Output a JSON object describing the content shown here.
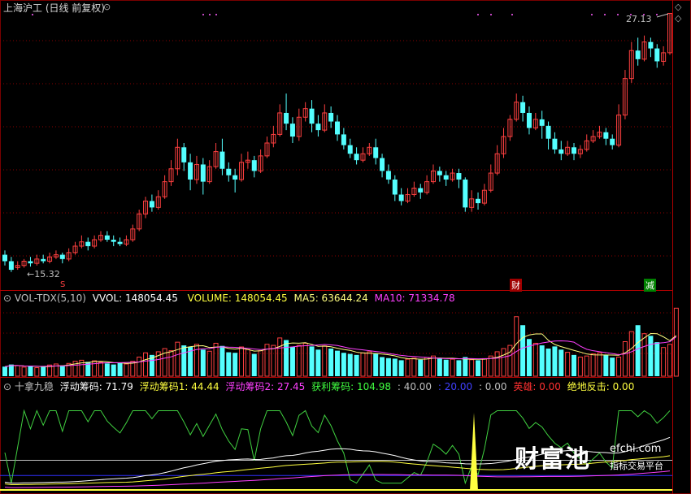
{
  "main": {
    "title": "上海沪工 (日线 前复权)",
    "high_label": "27.13",
    "low_label": "←15.32",
    "marker_s": "S",
    "marker_cai": "财",
    "marker_jian": "减",
    "candles": [
      [
        15.9,
        15.6,
        16.1,
        15.4
      ],
      [
        15.6,
        15.2,
        15.8,
        15.1
      ],
      [
        15.3,
        15.4,
        15.6,
        15.2
      ],
      [
        15.4,
        15.6,
        15.7,
        15.3
      ],
      [
        15.6,
        15.5,
        15.8,
        15.35
      ],
      [
        15.5,
        15.7,
        15.9,
        15.4
      ],
      [
        15.7,
        15.6,
        15.9,
        15.5
      ],
      [
        15.6,
        15.8,
        16.0,
        15.5
      ],
      [
        15.8,
        15.9,
        16.1,
        15.7
      ],
      [
        15.9,
        15.7,
        16.0,
        15.5
      ],
      [
        15.7,
        16.0,
        16.2,
        15.6
      ],
      [
        16.0,
        16.3,
        16.5,
        15.9
      ],
      [
        16.3,
        16.5,
        16.8,
        16.2
      ],
      [
        16.5,
        16.3,
        16.7,
        16.1
      ],
      [
        16.3,
        16.6,
        16.8,
        16.2
      ],
      [
        16.6,
        16.8,
        17.0,
        16.5
      ],
      [
        16.8,
        16.6,
        17.0,
        16.5
      ],
      [
        16.6,
        16.5,
        16.8,
        16.3
      ],
      [
        16.5,
        16.4,
        16.7,
        16.3
      ],
      [
        16.4,
        16.6,
        16.8,
        16.3
      ],
      [
        16.6,
        17.1,
        17.3,
        16.5
      ],
      [
        17.1,
        17.8,
        18.0,
        17.0
      ],
      [
        17.8,
        18.4,
        18.6,
        17.6
      ],
      [
        18.4,
        18.1,
        18.7,
        17.9
      ],
      [
        18.1,
        18.6,
        18.9,
        18.0
      ],
      [
        18.6,
        19.3,
        19.6,
        18.5
      ],
      [
        19.3,
        19.9,
        20.3,
        19.1
      ],
      [
        19.9,
        20.9,
        21.3,
        19.6
      ],
      [
        20.9,
        20.2,
        21.1,
        19.8
      ],
      [
        20.2,
        19.4,
        20.6,
        18.9
      ],
      [
        19.4,
        20.1,
        20.5,
        19.2
      ],
      [
        20.1,
        19.3,
        20.4,
        18.7
      ],
      [
        19.3,
        20.0,
        20.3,
        19.2
      ],
      [
        20.0,
        20.7,
        21.1,
        19.9
      ],
      [
        20.7,
        19.9,
        21.3,
        19.6
      ],
      [
        19.9,
        19.6,
        20.2,
        19.3
      ],
      [
        19.6,
        19.4,
        19.9,
        18.8
      ],
      [
        19.4,
        20.2,
        20.6,
        19.3
      ],
      [
        20.2,
        20.3,
        20.7,
        19.9
      ],
      [
        20.3,
        19.8,
        20.5,
        19.5
      ],
      [
        19.8,
        20.5,
        20.8,
        19.7
      ],
      [
        20.5,
        21.1,
        21.4,
        20.4
      ],
      [
        21.1,
        21.5,
        21.9,
        20.9
      ],
      [
        21.5,
        22.5,
        22.9,
        21.4
      ],
      [
        22.5,
        22.0,
        23.4,
        21.7
      ],
      [
        22.0,
        21.4,
        22.3,
        21.1
      ],
      [
        21.4,
        22.3,
        22.7,
        21.2
      ],
      [
        22.3,
        22.7,
        23.0,
        22.1
      ],
      [
        22.7,
        22.0,
        23.1,
        21.6
      ],
      [
        22.0,
        21.7,
        22.4,
        21.4
      ],
      [
        21.7,
        22.5,
        22.9,
        21.6
      ],
      [
        22.5,
        22.1,
        22.8,
        21.8
      ],
      [
        22.1,
        21.5,
        22.4,
        21.2
      ],
      [
        21.5,
        21.0,
        21.8,
        20.8
      ],
      [
        21.0,
        20.6,
        21.3,
        20.4
      ],
      [
        20.6,
        20.3,
        20.9,
        20.1
      ],
      [
        20.3,
        20.6,
        20.9,
        20.2
      ],
      [
        20.6,
        20.9,
        21.1,
        20.5
      ],
      [
        20.9,
        20.4,
        21.3,
        20.1
      ],
      [
        20.4,
        19.8,
        20.6,
        19.5
      ],
      [
        19.8,
        19.4,
        20.1,
        19.2
      ],
      [
        19.4,
        18.7,
        19.6,
        18.4
      ],
      [
        18.7,
        18.4,
        19.0,
        18.2
      ],
      [
        18.4,
        18.7,
        19.0,
        18.3
      ],
      [
        18.7,
        19.0,
        19.3,
        18.6
      ],
      [
        19.0,
        18.8,
        19.2,
        18.5
      ],
      [
        18.8,
        19.3,
        19.6,
        18.7
      ],
      [
        19.3,
        19.8,
        20.1,
        19.2
      ],
      [
        19.8,
        19.6,
        20.0,
        19.3
      ],
      [
        19.6,
        19.4,
        19.8,
        19.1
      ],
      [
        19.4,
        19.7,
        19.9,
        19.3
      ],
      [
        19.7,
        19.4,
        19.9,
        19.0
      ],
      [
        19.4,
        18.1,
        19.5,
        17.9
      ],
      [
        18.1,
        18.5,
        18.9,
        17.9
      ],
      [
        18.5,
        18.3,
        18.8,
        18.0
      ],
      [
        18.3,
        18.9,
        19.2,
        18.2
      ],
      [
        18.9,
        19.7,
        20.1,
        18.8
      ],
      [
        19.7,
        20.6,
        21.0,
        19.6
      ],
      [
        20.6,
        21.4,
        21.8,
        20.4
      ],
      [
        21.4,
        22.2,
        22.4,
        21.2
      ],
      [
        22.2,
        23.0,
        23.4,
        22.1
      ],
      [
        23.0,
        22.5,
        23.3,
        22.1
      ],
      [
        22.5,
        21.8,
        22.8,
        21.5
      ],
      [
        21.8,
        22.2,
        22.5,
        21.7
      ],
      [
        22.2,
        21.9,
        22.6,
        21.3
      ],
      [
        21.9,
        21.3,
        22.1,
        20.8
      ],
      [
        21.3,
        20.8,
        21.6,
        20.6
      ],
      [
        20.8,
        20.6,
        21.2,
        20.3
      ],
      [
        20.6,
        20.9,
        21.2,
        20.5
      ],
      [
        20.9,
        20.6,
        21.1,
        20.3
      ],
      [
        20.6,
        20.8,
        21.0,
        20.4
      ],
      [
        20.8,
        21.2,
        21.5,
        20.7
      ],
      [
        21.2,
        21.4,
        21.7,
        21.1
      ],
      [
        21.4,
        21.6,
        21.9,
        21.3
      ],
      [
        21.6,
        21.3,
        21.8,
        21.0
      ],
      [
        21.3,
        21.0,
        21.5,
        20.8
      ],
      [
        21.0,
        22.4,
        22.9,
        20.9
      ],
      [
        22.4,
        24.1,
        24.5,
        22.2
      ],
      [
        24.1,
        25.4,
        25.8,
        23.9
      ],
      [
        25.4,
        25.0,
        26.0,
        24.7
      ],
      [
        25.0,
        25.8,
        26.1,
        24.9
      ],
      [
        25.8,
        25.5,
        26.0,
        25.1
      ],
      [
        25.5,
        24.9,
        25.7,
        24.6
      ],
      [
        24.9,
        25.3,
        25.6,
        24.7
      ],
      [
        25.3,
        27.13,
        27.13,
        25.2
      ]
    ]
  },
  "vol": {
    "title": "VOL-TDX(5,10)",
    "vvol": "VVOL: 148054.45",
    "volume": "VOLUME: 148054.45",
    "ma5": "MA5: 63644.24",
    "ma10": "MA10: 71334.78",
    "values": [
      18,
      22,
      20,
      17,
      19,
      16,
      18,
      21,
      23,
      20,
      24,
      28,
      30,
      27,
      29,
      26,
      24,
      22,
      25,
      23,
      28,
      36,
      44,
      40,
      46,
      52,
      48,
      64,
      58,
      55,
      60,
      50,
      47,
      62,
      57,
      45,
      44,
      55,
      50,
      42,
      48,
      60,
      58,
      72,
      68,
      55,
      58,
      62,
      56,
      50,
      57,
      52,
      48,
      44,
      42,
      40,
      44,
      46,
      42,
      36,
      34,
      33,
      30,
      32,
      34,
      31,
      35,
      38,
      33,
      31,
      32,
      30,
      36,
      31,
      30,
      33,
      38,
      46,
      52,
      58,
      112,
      96,
      70,
      62,
      58,
      52,
      56,
      50,
      45,
      40,
      36,
      38,
      42,
      44,
      40,
      35,
      36,
      65,
      84,
      96,
      80,
      76,
      64,
      54,
      60,
      128
    ],
    "colors": {
      "up": "#ff4040",
      "down": "#54ffff",
      "ma5": "#ffff80",
      "ma10": "#ff40ff",
      "volume": "#ffffff"
    }
  },
  "ind": {
    "title": "十拿九稳",
    "l1": "浮动筹码: 71.79",
    "l2": "浮动筹码1: 44.44",
    "l3": "浮动筹码2: 27.45",
    "l4": "获利筹码: 104.98",
    "l5": ": 40.00",
    "l6": ": 20.00",
    "l7": ": 0.00",
    "l8": "英雄: 0.00",
    "l9": "绝地反击: 0.00"
  },
  "watermark": {
    "brand": "财富池",
    "domain": "efchi.com",
    "slogan": "指标交易平台"
  },
  "colors": {
    "up": "#ff4040",
    "down": "#54ffff",
    "grid": "#8b0000",
    "text": "#c0c0c0"
  }
}
